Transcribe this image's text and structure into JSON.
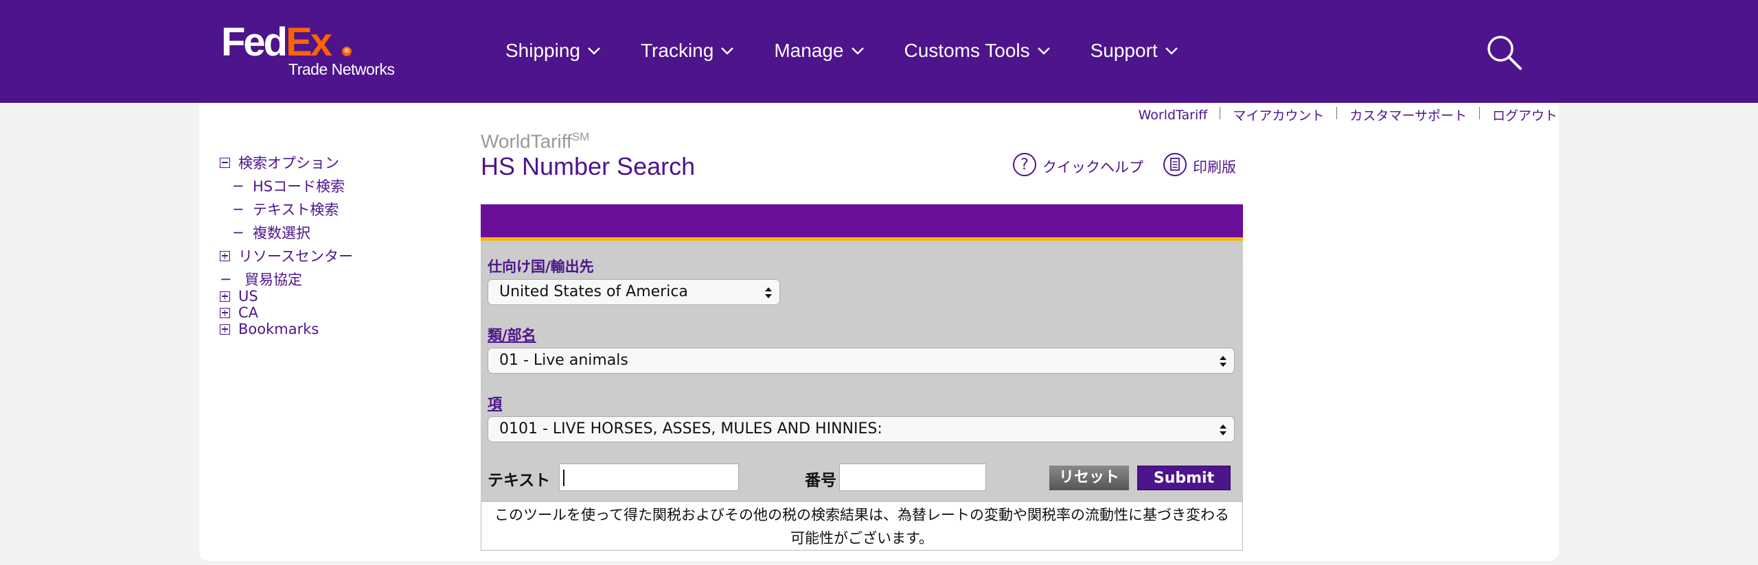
{
  "header": {
    "logo": {
      "fed": "Fed",
      "ex": "Ex",
      "reg": "®",
      "subtitle": "Trade Networks"
    },
    "nav": [
      {
        "label": "Shipping"
      },
      {
        "label": "Tracking"
      },
      {
        "label": "Manage"
      },
      {
        "label": "Customs Tools"
      },
      {
        "label": "Support"
      }
    ],
    "brand_color": "#4d148c",
    "accent_color": "#ff6200"
  },
  "util_links": [
    "WorldTariff",
    "マイアカウント",
    "カスタマーサポート",
    "ログアウト"
  ],
  "sidebar": {
    "search_options": {
      "label": "検索オプション",
      "icon": "minus-box-icon"
    },
    "search_children": [
      "HSコード検索",
      "テキスト検索",
      "複数選択"
    ],
    "resource_center": {
      "label": "リソースセンター",
      "icon": "plus-box-icon"
    },
    "trade_agreements": {
      "label": "貿易協定"
    },
    "nodes": [
      {
        "label": "US",
        "icon": "plus-box-icon"
      },
      {
        "label": "CA",
        "icon": "plus-box-icon"
      },
      {
        "label": "Bookmarks",
        "icon": "plus-box-icon"
      }
    ]
  },
  "main": {
    "brand": "WorldTariff",
    "brand_sup": "SM",
    "title": "HS Number Search",
    "quick_help": "クイックヘルプ",
    "print_version": "印刷版"
  },
  "form": {
    "destination_label": "仕向け国/輸出先",
    "destination_value": "United States of America",
    "chapter_label": "類/部名",
    "chapter_value": "01 - Live animals",
    "heading_label": "項",
    "heading_value": "0101 - LIVE HORSES, ASSES, MULES AND HINNIES:",
    "text_label": "テキスト",
    "text_value": "",
    "number_label": "番号",
    "number_value": "",
    "reset_label": "リセット",
    "submit_label": "Submit",
    "disclaimer": "このツールを使って得た関税およびその他の税の検索結果は、為替レートの変動や関税率の流動性に基づき変わる可能性がございます。"
  }
}
